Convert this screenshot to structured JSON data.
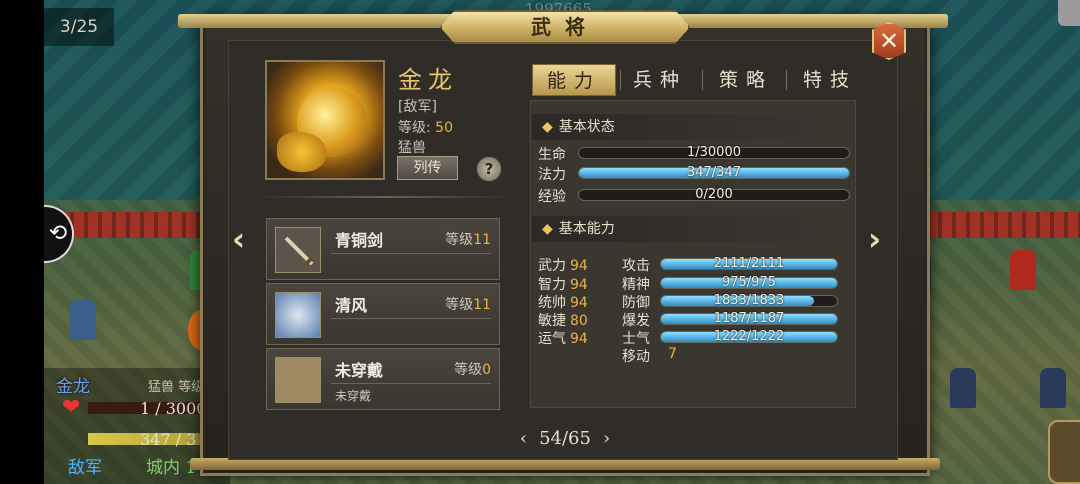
{
  "hud": {
    "page_counter": "3/25",
    "top_faded_number": "1997665",
    "unit_name": "金龙",
    "unit_type": "猛兽 等级",
    "unit_hp": "1 / 3000",
    "unit_mp": "347 / 3",
    "unit_side": "敌军",
    "unit_location": "城内 1"
  },
  "window": {
    "title": "武将",
    "close_icon": "close-icon"
  },
  "hero": {
    "name": "金龙",
    "faction": "[敌军]",
    "level_label": "等级:",
    "level_value": "50",
    "category": "猛兽",
    "bio_button": "列传",
    "help_button": "?"
  },
  "equipment": [
    {
      "name": "青铜剑",
      "level_label": "等级",
      "level": "11",
      "sub": ""
    },
    {
      "name": "清风",
      "level_label": "等级",
      "level": "11",
      "sub": ""
    },
    {
      "name": "未穿戴",
      "level_label": "等级",
      "level": "0",
      "sub": "未穿戴"
    }
  ],
  "tabs": [
    "能力",
    "兵种",
    "策略",
    "特技"
  ],
  "active_tab": "能力",
  "basic_status": {
    "header": "基本状态",
    "rows": [
      {
        "label": "生命",
        "text": "1/30000",
        "fraction": 3e-05
      },
      {
        "label": "法力",
        "text": "347/347",
        "fraction": 1.0
      },
      {
        "label": "经验",
        "text": "0/200",
        "fraction": 0.0
      }
    ]
  },
  "basic_ability": {
    "header": "基本能力",
    "attrs": [
      {
        "label": "武力",
        "value": "94"
      },
      {
        "label": "智力",
        "value": "94"
      },
      {
        "label": "统帅",
        "value": "94"
      },
      {
        "label": "敏捷",
        "value": "80"
      },
      {
        "label": "运气",
        "value": "94"
      }
    ],
    "bars": [
      {
        "label": "攻击",
        "text": "2111/2111",
        "fraction": 1.0
      },
      {
        "label": "精神",
        "text": "975/975",
        "fraction": 1.0
      },
      {
        "label": "防御",
        "text": "1833/1833",
        "fraction": 0.87
      },
      {
        "label": "爆发",
        "text": "1187/1187",
        "fraction": 1.0
      },
      {
        "label": "士气",
        "text": "1222/1222",
        "fraction": 1.0
      }
    ],
    "move_label": "移动",
    "move_value": "7"
  },
  "pager": {
    "prev": "‹",
    "current": "54/65",
    "next": "›"
  }
}
